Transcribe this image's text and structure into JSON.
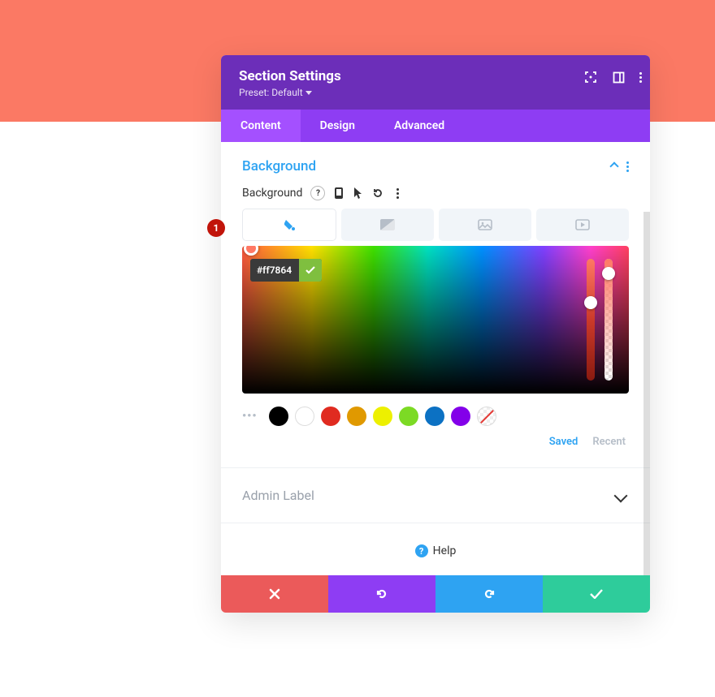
{
  "orange_color": "#FB7964",
  "header": {
    "title": "Section Settings",
    "preset": "Preset: Default"
  },
  "tabs": {
    "content": "Content",
    "design": "Design",
    "advanced": "Advanced"
  },
  "background": {
    "title": "Background",
    "label": "Background"
  },
  "picker": {
    "hex": "#ff7864"
  },
  "swatches": {
    "colors": [
      "#000000",
      "#FFFFFF",
      "#E02B20",
      "#E09900",
      "#EDF000",
      "#7CDA24",
      "#0C71C3",
      "#8300E9"
    ]
  },
  "links": {
    "saved": "Saved",
    "recent": "Recent"
  },
  "admin": {
    "label": "Admin Label"
  },
  "help": {
    "label": "Help"
  },
  "annotation": {
    "num": "1"
  }
}
